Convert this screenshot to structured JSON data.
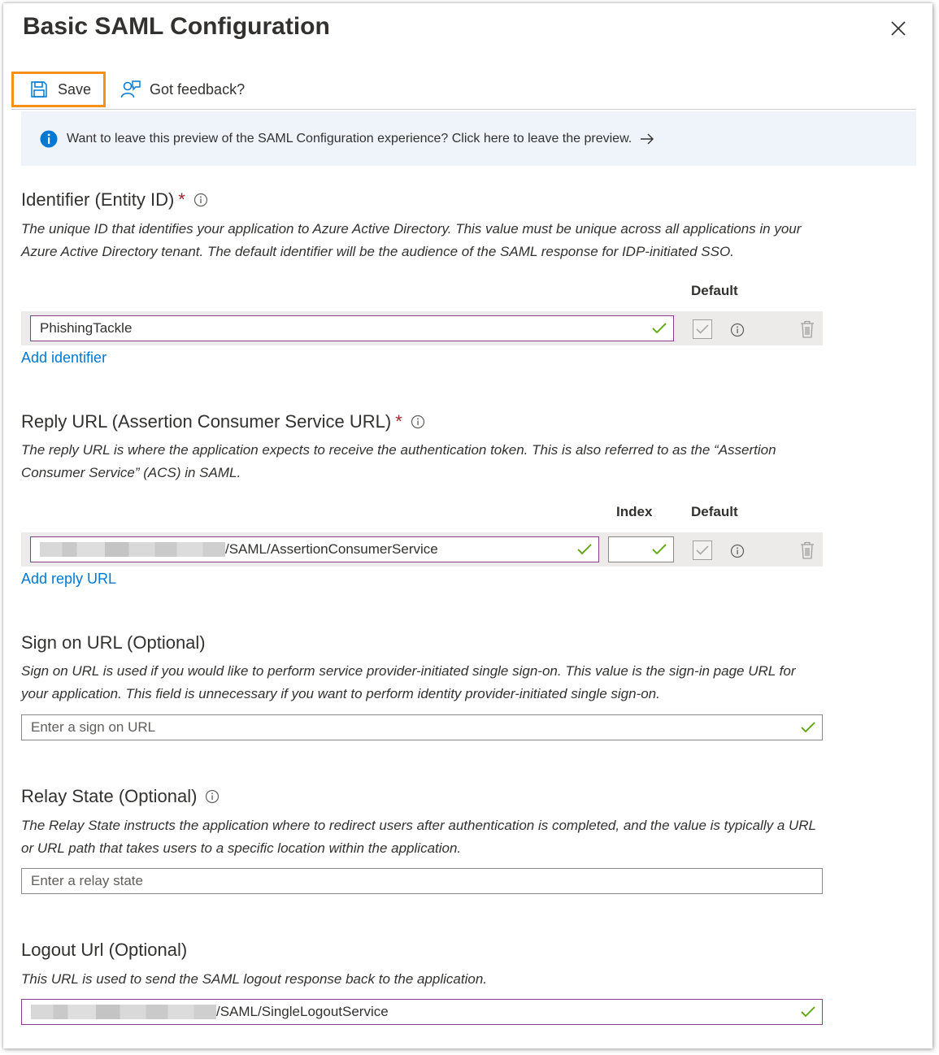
{
  "panel": {
    "title": "Basic SAML Configuration"
  },
  "toolbar": {
    "save_label": "Save",
    "feedback_label": "Got feedback?"
  },
  "banner": {
    "message": "Want to leave this preview of the SAML Configuration experience? Click here to leave the preview."
  },
  "identifier": {
    "title": "Identifier (Entity ID)",
    "required_mark": "*",
    "description": "The unique ID that identifies your application to Azure Active Directory. This value must be unique across all applications in your Azure Active Directory tenant. The default identifier will be the audience of the SAML response for IDP-initiated SSO.",
    "default_header": "Default",
    "value": "PhishingTackle",
    "add_link": "Add identifier"
  },
  "reply_url": {
    "title": "Reply URL (Assertion Consumer Service URL)",
    "required_mark": "*",
    "description": "The reply URL is where the application expects to receive the authentication token. This is also referred to as the “Assertion Consumer Service” (ACS) in SAML.",
    "index_header": "Index",
    "default_header": "Default",
    "value_suffix": "/SAML/AssertionConsumerService",
    "index_value": "",
    "add_link": "Add reply URL"
  },
  "sign_on": {
    "title": "Sign on URL (Optional)",
    "description": "Sign on URL is used if you would like to perform service provider-initiated single sign-on. This value is the sign-in page URL for your application. This field is unnecessary if you want to perform identity provider-initiated single sign-on.",
    "placeholder": "Enter a sign on URL"
  },
  "relay_state": {
    "title": "Relay State (Optional)",
    "description": "The Relay State instructs the application where to redirect users after authentication is completed, and the value is typically a URL or URL path that takes users to a specific location within the application.",
    "placeholder": "Enter a relay state"
  },
  "logout": {
    "title": "Logout Url (Optional)",
    "description": "This URL is used to send the SAML logout response back to the application.",
    "value_suffix": "/SAML/SingleLogoutService"
  },
  "colors": {
    "highlight": "#f39119",
    "link": "#0078d4",
    "valid_check": "#57a300",
    "active_border": "#8a3d8f",
    "banner_bg": "#eff4fb"
  }
}
